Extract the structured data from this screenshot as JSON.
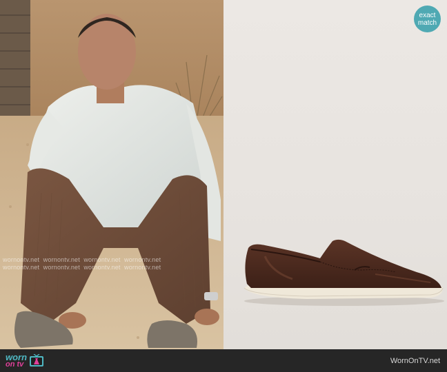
{
  "badge": {
    "line1": "exact",
    "line2": "match"
  },
  "watermark": {
    "text": "wornontv.net"
  },
  "footer": {
    "logo_line1": "worn",
    "logo_line2": "on tv",
    "site_url": "WornOnTV.net"
  },
  "images": {
    "left": "man in white shirt and brown corduroy trousers sitting on sandy ground",
    "right": "brown leather slip-on loafer with white sole"
  },
  "colors": {
    "badge": "#4fa9b3",
    "footer_bg": "#262626",
    "logo_teal": "#4fb7c2",
    "logo_pink": "#e0409a"
  }
}
